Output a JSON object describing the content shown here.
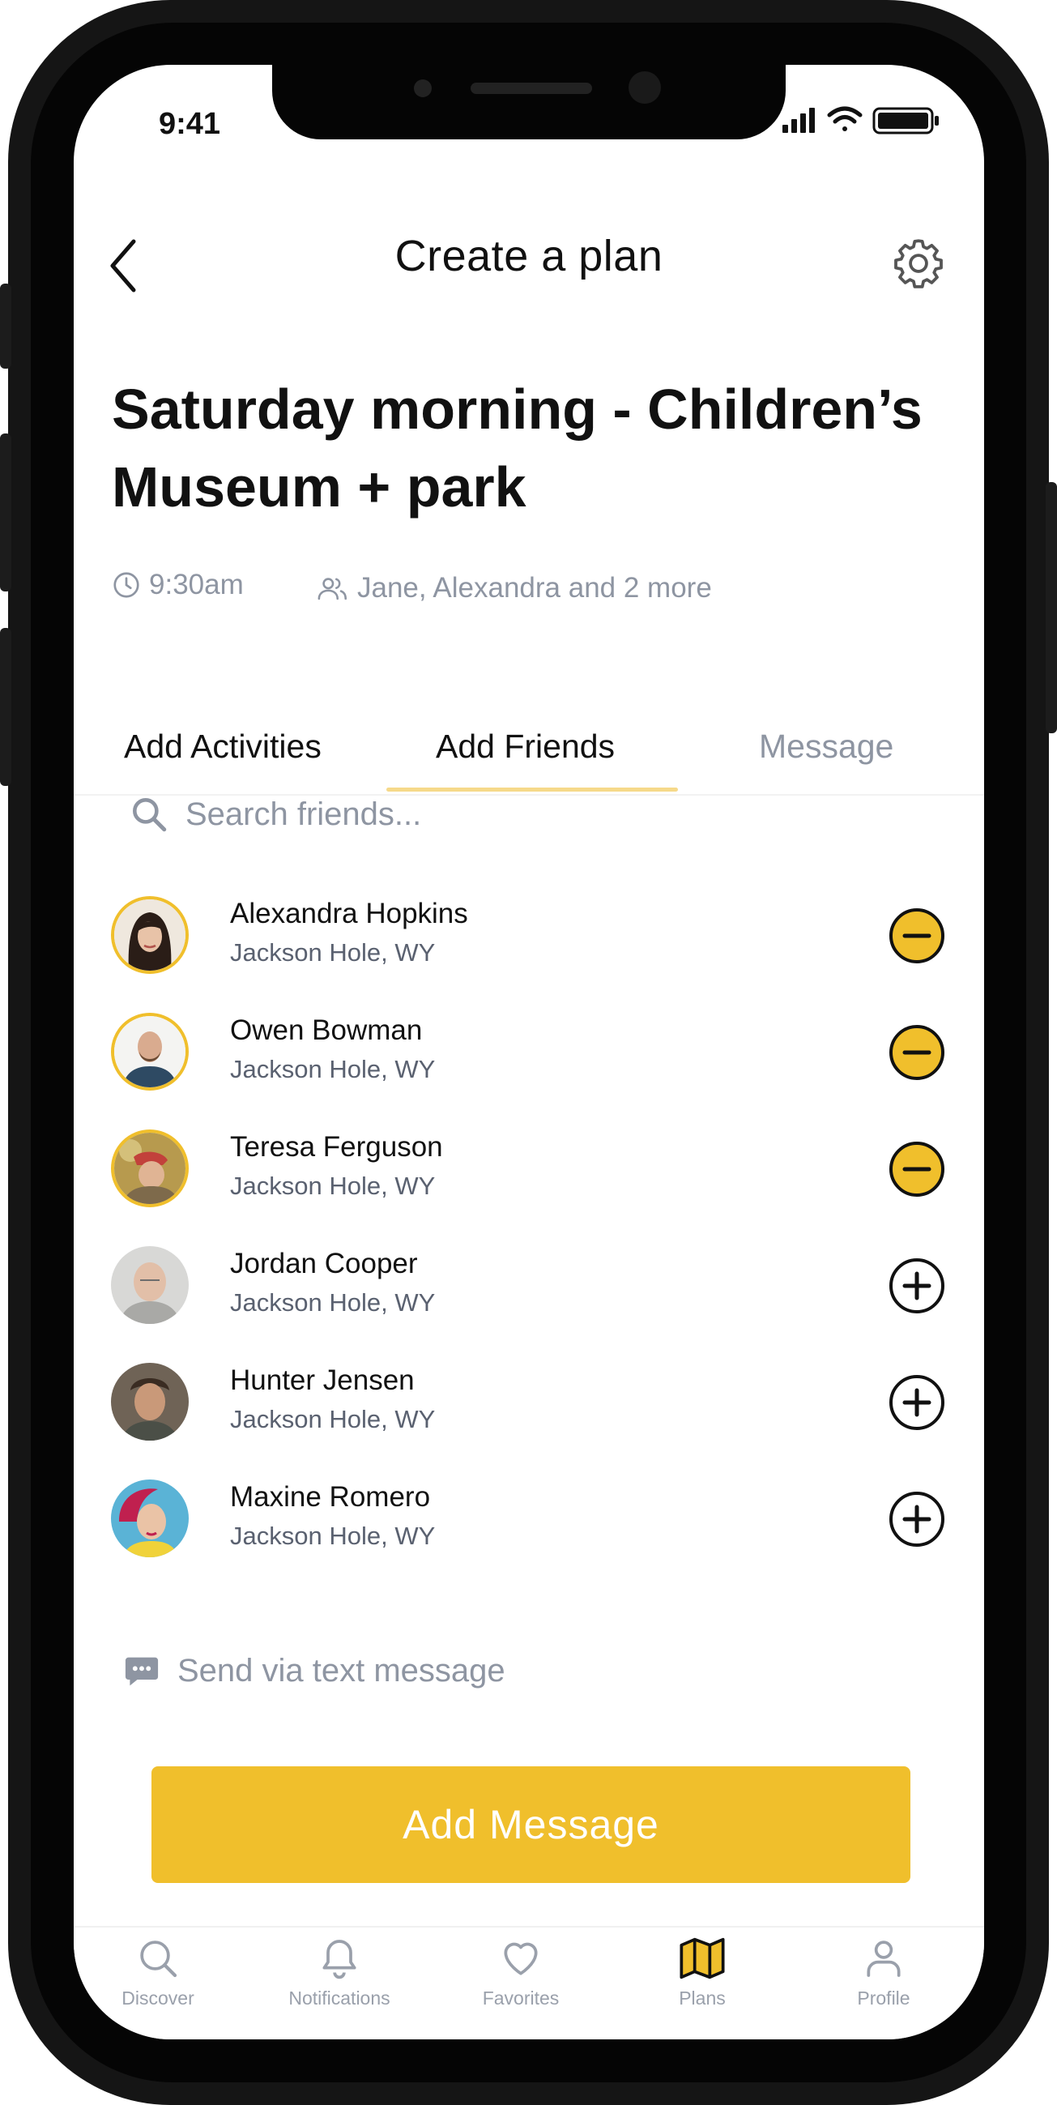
{
  "status_bar": {
    "time": "9:41"
  },
  "header": {
    "title": "Create a plan"
  },
  "plan": {
    "title": "Saturday morning - Children’s Museum + park",
    "time": "9:30am",
    "people": "Jane, Alexandra and 2 more"
  },
  "tabs": [
    {
      "label": "Add Activities"
    },
    {
      "label": "Add Friends"
    },
    {
      "label": "Message"
    }
  ],
  "search": {
    "placeholder": "Search friends..."
  },
  "friends": [
    {
      "name": "Alexandra Hopkins",
      "location": "Jackson Hole, WY",
      "added": true,
      "action_icon": "minus-circle-icon"
    },
    {
      "name": "Owen Bowman",
      "location": "Jackson Hole, WY",
      "added": true,
      "action_icon": "minus-circle-icon"
    },
    {
      "name": "Teresa Ferguson",
      "location": "Jackson Hole, WY",
      "added": true,
      "action_icon": "minus-circle-icon"
    },
    {
      "name": "Jordan Cooper",
      "location": "Jackson Hole, WY",
      "added": false,
      "action_icon": "plus-circle-icon"
    },
    {
      "name": "Hunter Jensen",
      "location": "Jackson Hole, WY",
      "added": false,
      "action_icon": "plus-circle-icon"
    },
    {
      "name": "Maxine Romero",
      "location": "Jackson Hole, WY",
      "added": false,
      "action_icon": "plus-circle-icon"
    }
  ],
  "sms": {
    "label": "Send via text message"
  },
  "cta": {
    "label": "Add Message"
  },
  "nav": [
    {
      "label": "Discover",
      "icon": "search-icon"
    },
    {
      "label": "Notifications",
      "icon": "bell-icon"
    },
    {
      "label": "Favorites",
      "icon": "heart-icon"
    },
    {
      "label": "Plans",
      "icon": "map-icon"
    },
    {
      "label": "Profile",
      "icon": "person-icon"
    }
  ],
  "colors": {
    "accent": "#F0BF2C",
    "muted_text": "#8E95A2",
    "active_tab_underline": "#F6D98A"
  }
}
